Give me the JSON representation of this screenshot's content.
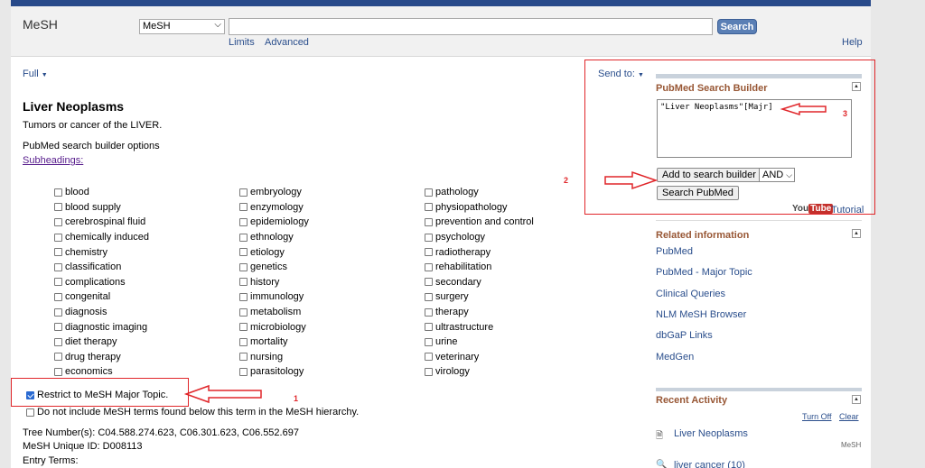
{
  "header": {
    "logo": "MeSH",
    "db_select": "MeSH",
    "search_button": "Search",
    "limits": "Limits",
    "advanced": "Advanced",
    "help": "Help"
  },
  "main": {
    "display_format": "Full",
    "title": "Liver Neoplasms",
    "description": "Tumors or cancer of the LIVER.",
    "options_label": "PubMed search builder options",
    "subheadings_link": "Subheadings:",
    "subheadings_col1": [
      "blood",
      "blood supply",
      "cerebrospinal fluid",
      "chemically induced",
      "chemistry",
      "classification",
      "complications",
      "congenital",
      "diagnosis",
      "diagnostic imaging",
      "diet therapy",
      "drug therapy",
      "economics"
    ],
    "subheadings_col2": [
      "embryology",
      "enzymology",
      "epidemiology",
      "ethnology",
      "etiology",
      "genetics",
      "history",
      "immunology",
      "metabolism",
      "microbiology",
      "mortality",
      "nursing",
      "parasitology"
    ],
    "subheadings_col3": [
      "pathology",
      "physiopathology",
      "prevention and control",
      "psychology",
      "radiotherapy",
      "rehabilitation",
      "secondary",
      "surgery",
      "therapy",
      "ultrastructure",
      "urine",
      "veterinary",
      "virology"
    ],
    "restrict_label": "Restrict to MeSH Major Topic.",
    "restrict_checked": true,
    "donot_label": "Do not include MeSH terms found below this term in the MeSH hierarchy.",
    "tree_numbers": "Tree Number(s): C04.588.274.623, C06.301.623, C06.552.697",
    "unique_id": "MeSH Unique ID: D008113",
    "entry_terms": "Entry Terms:"
  },
  "sidebar": {
    "send_to": "Send to:",
    "builder_title": "PubMed Search Builder",
    "builder_query": "\"Liver Neoplasms\"[Majr]",
    "add_button": "Add to search builder",
    "and_select": "AND",
    "search_pubmed_button": "Search PubMed",
    "youtube_you": "You",
    "youtube_tube": "Tube",
    "tutorial": "Tutorial",
    "related_title": "Related information",
    "related_links": [
      "PubMed",
      "PubMed - Major Topic",
      "Clinical Queries",
      "NLM MeSH Browser",
      "dbGaP Links",
      "MedGen"
    ],
    "recent_title": "Recent Activity",
    "turn_off": "Turn Off",
    "clear": "Clear",
    "recent_item1": "Liver Neoplasms",
    "recent_item1_db": "MeSH",
    "recent_item2": "liver cancer (10)"
  },
  "annotations": {
    "label1": "1",
    "label2": "2",
    "label3": "3",
    "color": "#e0262a"
  }
}
